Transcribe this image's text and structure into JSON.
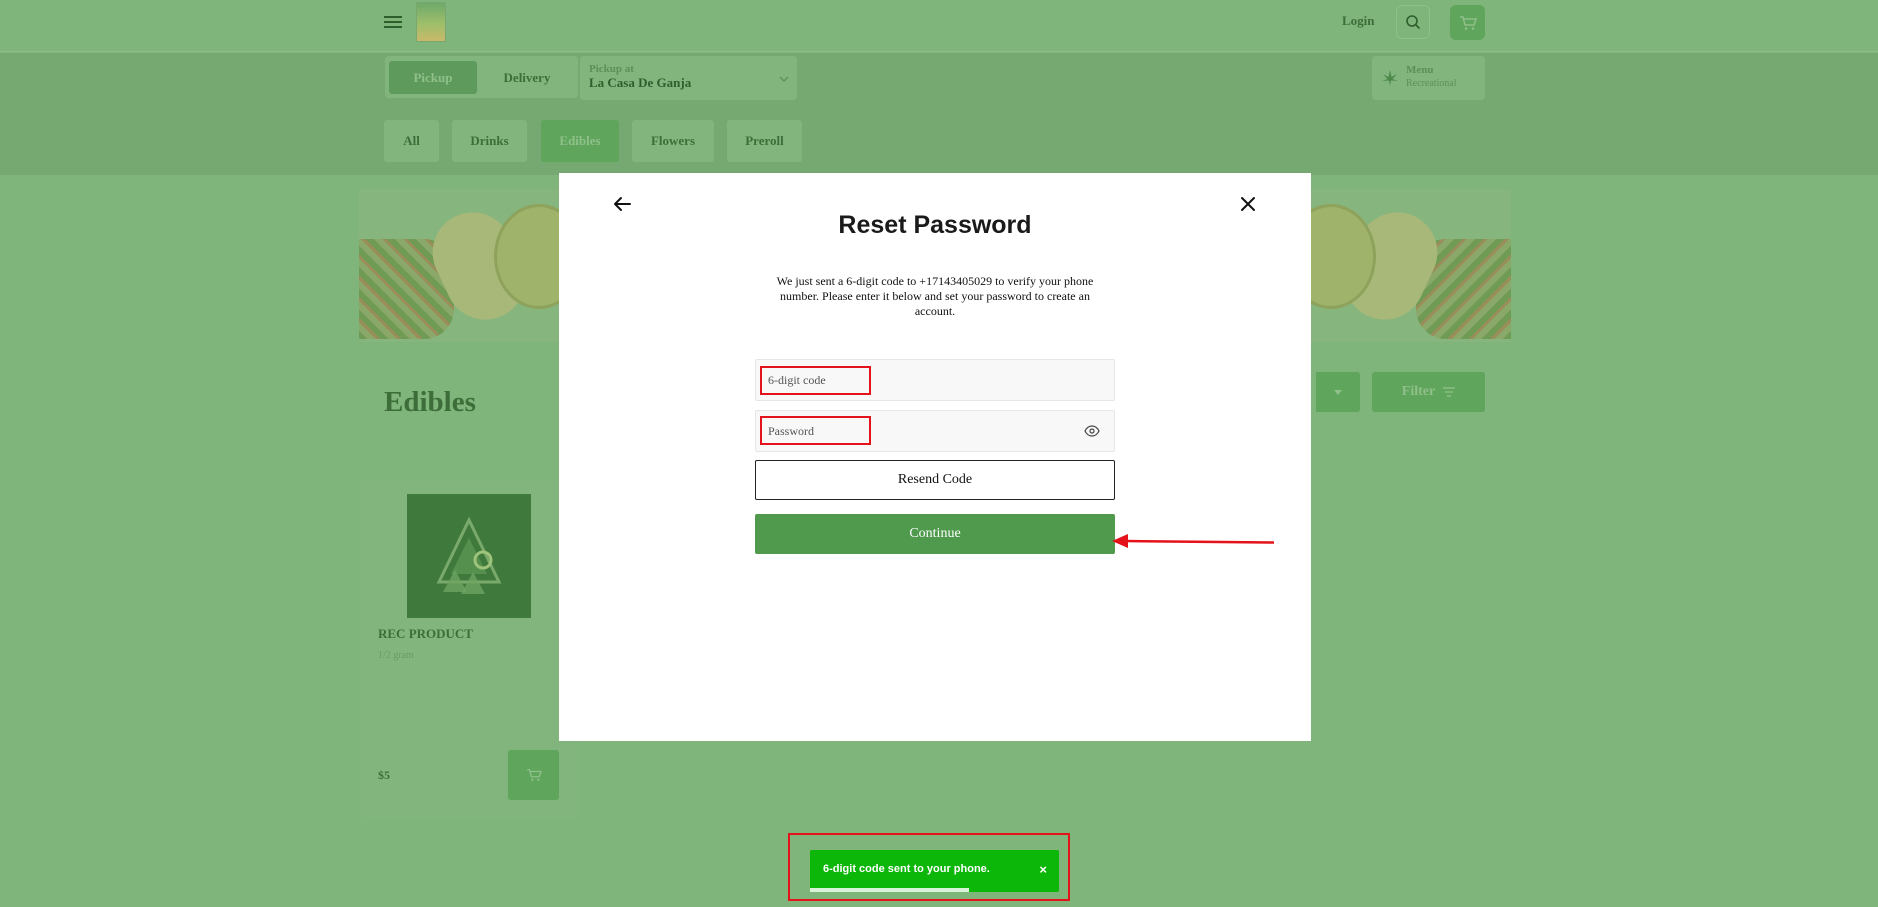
{
  "colors": {
    "overlay_green": "#7fb47b",
    "accent": "#5fa55b",
    "continue": "#4f9a4c",
    "toast": "#0db70a",
    "annotation_red": "#e3121b"
  },
  "header": {
    "menu_icon": "hamburger-icon",
    "login_label": "Login",
    "search_icon": "search-icon",
    "cart_icon": "cart-icon"
  },
  "order": {
    "pickup_label": "Pickup",
    "delivery_label": "Delivery",
    "pickup_at_label": "Pickup at",
    "pickup_location": "La Casa De Ganja",
    "menu_label": "Menu",
    "menu_value": "Recreational"
  },
  "categories": [
    "All",
    "Drinks",
    "Edibles",
    "Flowers",
    "Preroll"
  ],
  "active_category": "Edibles",
  "main": {
    "page_title": "Edibles",
    "filter_label": "Filter"
  },
  "product": {
    "name": "REC PRODUCT",
    "weight": "1/2 gram",
    "price": "$5"
  },
  "modal": {
    "title": "Reset Password",
    "description": "We just sent a 6-digit code to +17143405029 to verify your phone number. Please enter it below and set your password to create an account.",
    "code_placeholder": "6-digit code",
    "password_placeholder": "Password",
    "resend_label": "Resend Code",
    "continue_label": "Continue"
  },
  "toast": {
    "message": "6-digit code sent to your phone.",
    "close_symbol": "×",
    "progress": 0.64
  }
}
